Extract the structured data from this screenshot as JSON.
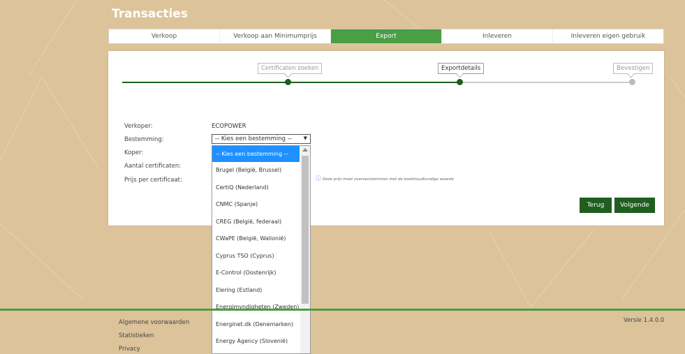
{
  "page_title": "Transacties",
  "tabs": [
    {
      "label": "Verkoop"
    },
    {
      "label": "Verkoop aan Minimumprijs"
    },
    {
      "label": "Export"
    },
    {
      "label": "Inleveren"
    },
    {
      "label": "Inleveren eigen gebruik"
    }
  ],
  "active_tab": "Export",
  "steps": [
    {
      "label": "Certificaten zoeken",
      "state": "done"
    },
    {
      "label": "Exportdetails",
      "state": "current"
    },
    {
      "label": "Bevestigen",
      "state": "pending"
    }
  ],
  "form": {
    "seller_label": "Verkoper:",
    "seller_value": "ECOPOWER",
    "destination_label": "Bestemming:",
    "destination_value": "-- Kies een bestemming --",
    "buyer_label": "Koper:",
    "count_label": "Aantal certificaten:",
    "price_label": "Prijs per certificaat:",
    "price_note": "Deze prijs moet overeenstemmen met de boekhoudkundige waarde"
  },
  "buttons": {
    "back": "Terug",
    "next": "Volgende"
  },
  "dropdown_options": [
    "-- Kies een bestemming --",
    "Brugel (België, Brussel)",
    "CertiQ (Nederland)",
    "CNMC (Spanje)",
    "CREG (België, federaal)",
    "CWaPE (België, Wallonië)",
    "Cyprus TSO (Cyprus)",
    "E-Control (Oostenrijk)",
    "Elering (Estland)",
    "Energimyndigheten (Zweden)",
    "Energinet.dk (Denemarken)",
    "Energy Agency (Slovenië)"
  ],
  "footer": {
    "links": [
      "Algemene voorwaarden",
      "Statistieken",
      "Privacy"
    ],
    "version": "Versie 1.4.0.0"
  },
  "colors": {
    "background": "#dcc39a",
    "accent_green": "#4a9e45",
    "dark_green": "#1f5e1e",
    "selected_blue": "#1e90ff"
  }
}
